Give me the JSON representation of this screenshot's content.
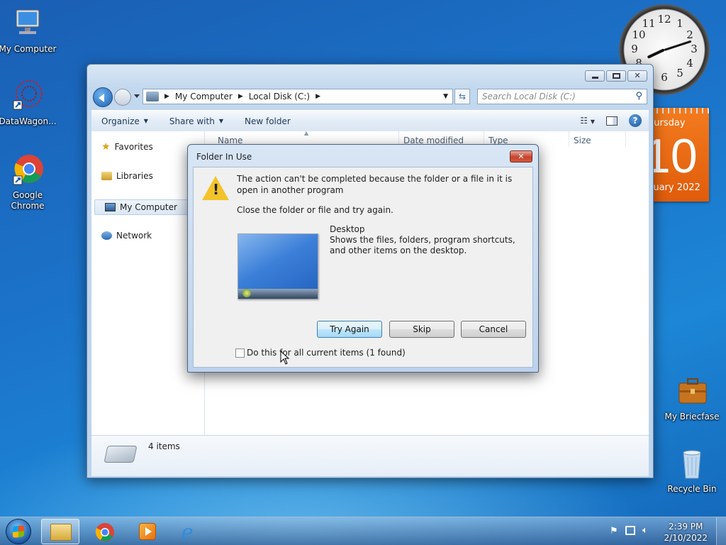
{
  "desktop": {
    "icons": [
      {
        "label": "My Computer"
      },
      {
        "label": "DataWagon..."
      },
      {
        "label": "Google Chrome"
      },
      {
        "label": "My Briecfase"
      },
      {
        "label": "Recycle Bin"
      }
    ]
  },
  "gadgets": {
    "clock_numbers": [
      "12",
      "1",
      "2",
      "3",
      "4",
      "5",
      "6",
      "7",
      "8",
      "9",
      "10",
      "11"
    ],
    "calendar": {
      "day": "hursday",
      "date": "10",
      "month": "ruary 2022"
    }
  },
  "explorer": {
    "breadcrumb": [
      "My Computer",
      "Local Disk (C:)"
    ],
    "search_placeholder": "Search Local Disk (C:)",
    "toolbar": {
      "organize": "Organize",
      "share_with": "Share with",
      "new_folder": "New folder"
    },
    "nav": {
      "favorites": "Favorites",
      "libraries": "Libraries",
      "my_computer": "My Computer",
      "network": "Network"
    },
    "columns": {
      "name": "Name",
      "date_modified": "Date modified",
      "type": "Type",
      "size": "Size"
    },
    "status": {
      "count": "4 items"
    }
  },
  "dialog": {
    "title": "Folder In Use",
    "message": "The action can't be completed because the folder or a file in it is open in another program",
    "instruction": "Close the folder or file and try again.",
    "item_name": "Desktop",
    "item_desc": "Shows the files, folders, program shortcuts, and other items on the desktop.",
    "buttons": {
      "try_again": "Try Again",
      "skip": "Skip",
      "cancel": "Cancel"
    },
    "checkbox_label": "Do this for all current items (1 found)",
    "checkbox_checked": false
  },
  "taskbar": {
    "time": "2:39 PM",
    "date": "2/10/2022"
  },
  "colors": {
    "warning": "#f3c32a",
    "calendar": "#e8650f",
    "accent": "#1b73c9"
  }
}
